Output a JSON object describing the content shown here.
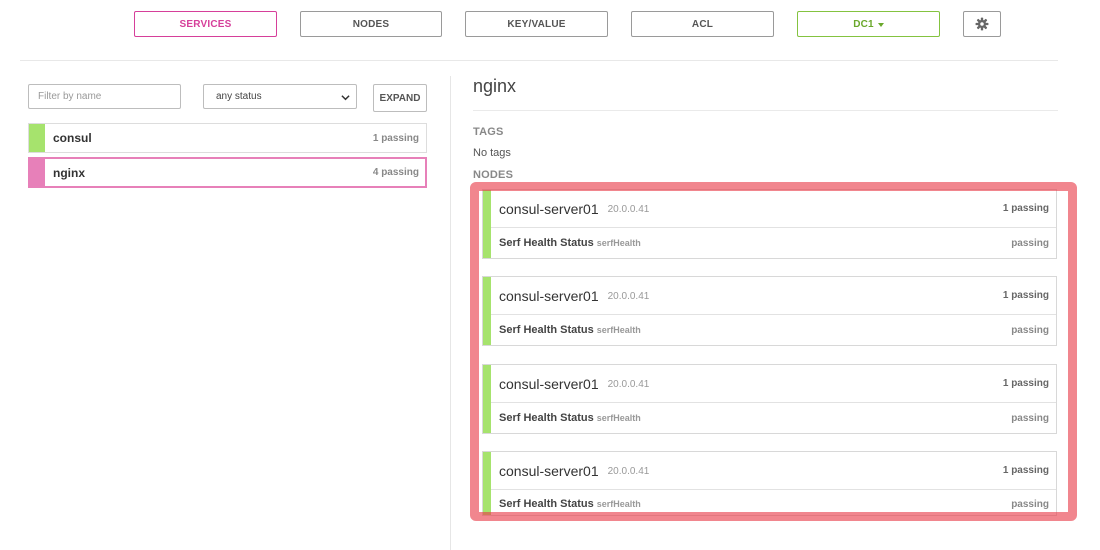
{
  "nav": {
    "services": "SERVICES",
    "nodes": "NODES",
    "key_value": "KEY/VALUE",
    "acl": "ACL",
    "datacenter": "DC1",
    "settings_icon": "gear-icon"
  },
  "filters": {
    "name_placeholder": "Filter by name",
    "status_selected": "any status",
    "expand_label": "EXPAND"
  },
  "services": [
    {
      "name": "consul",
      "count": "1 passing",
      "status_color": "#a6e36d"
    },
    {
      "name": "nginx",
      "count": "4 passing",
      "status_color": "#e780b9"
    }
  ],
  "detail": {
    "title": "nginx",
    "tags_heading": "TAGS",
    "tags_value": "No tags",
    "nodes_heading": "NODES",
    "nodes": [
      {
        "name": "consul-server01",
        "address": "20.0.0.41",
        "count": "1 passing",
        "check_name": "Serf Health Status",
        "check_id": "serfHealth",
        "check_status": "passing"
      },
      {
        "name": "consul-server01",
        "address": "20.0.0.41",
        "count": "1 passing",
        "check_name": "Serf Health Status",
        "check_id": "serfHealth",
        "check_status": "passing"
      },
      {
        "name": "consul-server01",
        "address": "20.0.0.41",
        "count": "1 passing",
        "check_name": "Serf Health Status",
        "check_id": "serfHealth",
        "check_status": "passing"
      },
      {
        "name": "consul-server01",
        "address": "20.0.0.41",
        "count": "1 passing",
        "check_name": "Serf Health Status",
        "check_id": "serfHealth",
        "check_status": "passing"
      }
    ]
  },
  "colors": {
    "passing": "#a6e36d",
    "accent": "#d63f9a",
    "dc_accent": "#84c340",
    "highlight": "#e83c48"
  }
}
